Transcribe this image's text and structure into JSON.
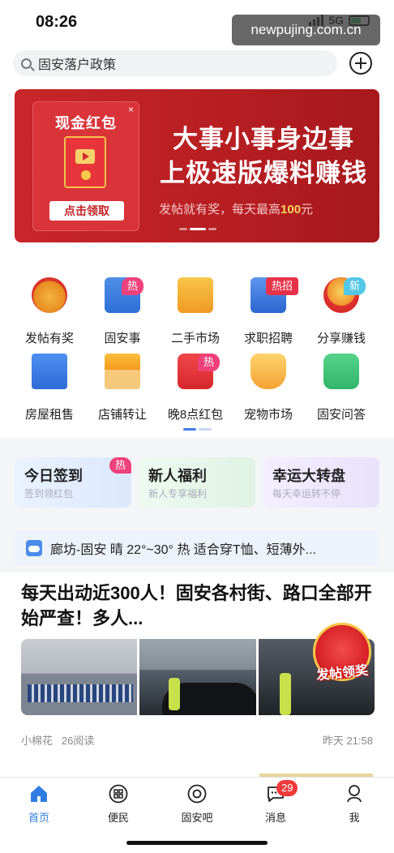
{
  "status": {
    "time": "08:26",
    "network": "5G"
  },
  "watermark": "newpujing.com.cn",
  "search": {
    "text": "固安落户政策"
  },
  "banner": {
    "card_title": "现金红包",
    "card_close": "×",
    "card_button": "点击领取",
    "headline_line1": "大事小事身边事",
    "headline_line2": "上极速版爆料赚钱",
    "sub_prefix": "发帖就有奖，每天最高",
    "sub_amount": "100",
    "sub_suffix": "元"
  },
  "services": [
    {
      "label": "发帖有奖",
      "icon": "money-bag-icon",
      "badge": ""
    },
    {
      "label": "固安事",
      "icon": "newspaper-icon",
      "badge": "热"
    },
    {
      "label": "二手市场",
      "icon": "box-icon",
      "badge": ""
    },
    {
      "label": "求职招聘",
      "icon": "suit-icon",
      "badge": "热招"
    },
    {
      "label": "分享赚钱",
      "icon": "red-envelope-icon",
      "badge": "新"
    },
    {
      "label": "房屋租售",
      "icon": "building-icon",
      "badge": ""
    },
    {
      "label": "店铺转让",
      "icon": "store-icon",
      "badge": ""
    },
    {
      "label": "晚8点红包",
      "icon": "red-packet-icon",
      "badge": "热"
    },
    {
      "label": "宠物市场",
      "icon": "pet-basket-icon",
      "badge": ""
    },
    {
      "label": "固安问答",
      "icon": "chat-bubble-icon",
      "badge": ""
    }
  ],
  "promos": [
    {
      "title": "今日签到",
      "sub": "签到领红包",
      "badge": "热"
    },
    {
      "title": "新人福利",
      "sub": "新人专享福利",
      "badge": ""
    },
    {
      "title": "幸运大转盘",
      "sub": "每天幸运转不停",
      "badge": ""
    }
  ],
  "weather": {
    "text": "廊坊-固安 晴 22°~30° 热 适合穿T恤、短薄外..."
  },
  "article": {
    "title": "每天出动近300人！固安各村街、路口全部开始严查！多人...",
    "author": "小棉花",
    "reads": "26阅读",
    "time": "昨天 21:58",
    "reward_label": "发帖领奖"
  },
  "tabs": [
    {
      "label": "首页",
      "icon": "home-icon"
    },
    {
      "label": "便民",
      "icon": "grid-services-icon"
    },
    {
      "label": "固安吧",
      "icon": "forum-icon"
    },
    {
      "label": "消息",
      "icon": "message-icon"
    },
    {
      "label": "我",
      "icon": "profile-icon"
    }
  ],
  "message_badge": "29",
  "colors": {
    "accent": "#2f7de0",
    "banner_red": "#c8262a",
    "hot_badge": "#f0417a"
  }
}
